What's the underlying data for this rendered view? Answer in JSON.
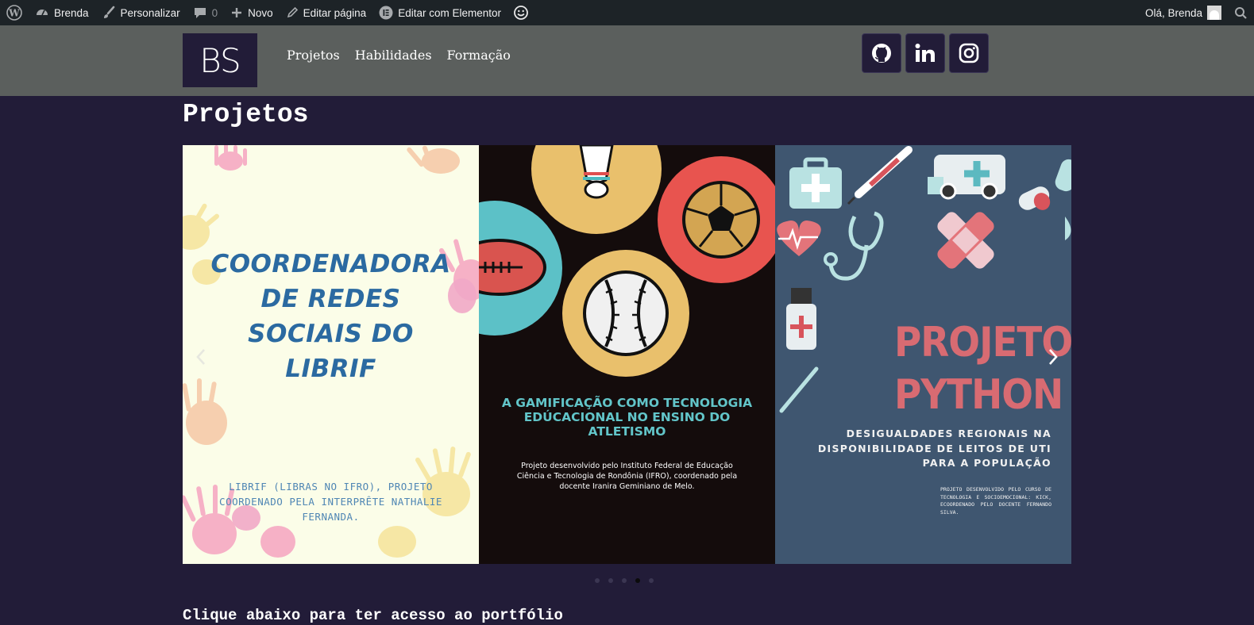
{
  "admin_bar": {
    "site_name": "Brenda",
    "customize": "Personalizar",
    "comments_count": "0",
    "new": "Novo",
    "edit_page": "Editar página",
    "edit_elementor": "Editar com Elementor",
    "greeting": "Olá, Brenda"
  },
  "header": {
    "logo_text": "BS",
    "nav": [
      "Projetos",
      "Habilidades",
      "Formação"
    ],
    "socials": [
      "github-icon",
      "linkedin-icon",
      "instagram-icon"
    ]
  },
  "main": {
    "title": "Projetos",
    "cta": "Clique abaixo para ter acesso ao portfólio"
  },
  "carousel": {
    "slides": [
      {
        "title": "COORDENADORA DE REDES SOCIAIS DO LIBRIF",
        "title_lines": [
          "COORDENADORA",
          "DE REDES",
          "SOCIAIS DO",
          "LIBRIF"
        ],
        "subtitle": "LIBRIF (LIBRAS NO IFRO), PROJETO COORDENADO PELA INTERPRÊTE NATHALIE FERNANDA."
      },
      {
        "title": "A GAMIFICAÇÃO COMO TECNOLOGIA EDÚCACIONAL NO ENSINO DO ATLETISMO",
        "subtitle": "Projeto desenvolvido pelo Instituto Federal de Educação Ciência e Tecnologia de Rondônia (IFRO), coordenado pela docente Iranira Geminiano de Melo."
      },
      {
        "title_line1": "PROJETO",
        "title_line2": "PYTHON",
        "subtitle": "DESIGUALDADES REGIONAIS NA DISPONIBILIDADE DE LEITOS DE UTI PARA A POPULAÇÃO",
        "small": "PROJETO DESENVOLVIDO PELO CURSO DE TECNOLOGIA E SOCIOEMOCIONAL: KICK, ECOORDENADO PELO DOCENTE FERNANDO SILVA."
      }
    ],
    "dots_count": 5,
    "active_dot": 3
  },
  "colors": {
    "admin_bar": "#1d2327",
    "header": "#5b5f5d",
    "background": "#221c38"
  }
}
